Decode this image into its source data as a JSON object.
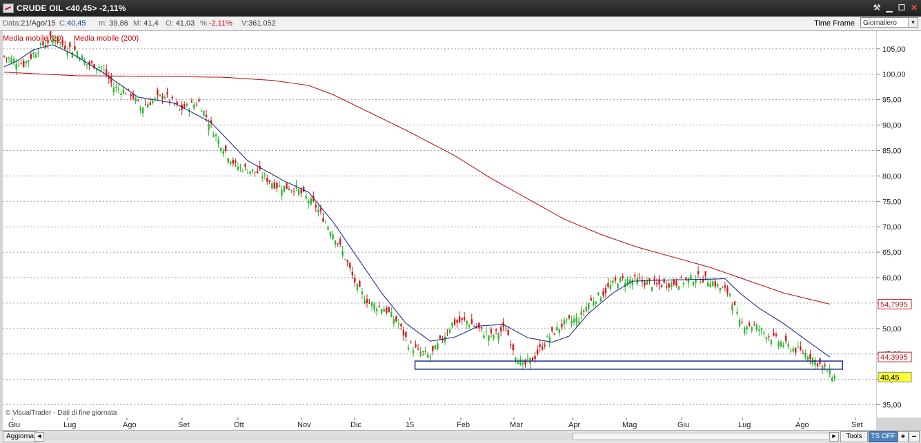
{
  "window": {
    "title": "CRUDE OIL <40,45> -2,11%"
  },
  "info": {
    "data_label": "Data:",
    "data_value": "21/Ago/15",
    "c_label": "C:",
    "c_value": "40,45",
    "m_label": "m:",
    "m_value": "39,86",
    "M_label": "M:",
    "M_value": "41,4",
    "o_label": "O:",
    "o_value": "41,03",
    "pct_label": "%:",
    "pct_value": "-2,11%",
    "v_label": "V:",
    "v_value": "361.052"
  },
  "timeframe": {
    "label": "Time Frame",
    "selected": "Giornaliero"
  },
  "legend": {
    "ma20": "Media mobile (20)",
    "ma200": "Media mobile (200)"
  },
  "watermark": "© VisualTrader - Dati di fine giornata",
  "bottombar": {
    "aggiorna": "Aggiorna",
    "tools": "Tools",
    "ts_off": "TS OFF",
    "plus": "+",
    "minus": "−"
  },
  "price_labels": {
    "ma200": "54,7995",
    "ma20": "44,3995",
    "last": "40,45"
  },
  "colors": {
    "up": "#2db82d",
    "down": "#d21a1a",
    "ma20": "#1c2f8c",
    "ma200": "#c01818",
    "support": "#1c2f8c",
    "last_bg": "#ffff33"
  },
  "chart_data": {
    "type": "candlestick",
    "y_ticks": [
      "105,00",
      "100,00",
      "95,00",
      "90,00",
      "85,00",
      "80,00",
      "75,00",
      "70,00",
      "65,00",
      "60,00",
      "55,00",
      "50,00",
      "45,00",
      "40,00",
      "35,00"
    ],
    "ylim": [
      32.5,
      108.5
    ],
    "x_ticks": [
      "Giu",
      "Lug",
      "Ago",
      "Set",
      "Ott",
      "Nov",
      "Dic",
      "15",
      "Feb",
      "Mar",
      "Apr",
      "Mag",
      "Giu",
      "Lug",
      "Ago",
      "Set"
    ],
    "price_path": [
      [
        0,
        103.5
      ],
      [
        8,
        102
      ],
      [
        14,
        105
      ],
      [
        20,
        107.3
      ],
      [
        25,
        105.5
      ],
      [
        30,
        104.5
      ],
      [
        34,
        102
      ],
      [
        40,
        101.5
      ],
      [
        45,
        97.5
      ],
      [
        52,
        96.2
      ],
      [
        56,
        93.5
      ],
      [
        62,
        95
      ],
      [
        66,
        96
      ],
      [
        72,
        93
      ],
      [
        80,
        94.5
      ],
      [
        88,
        87
      ],
      [
        95,
        82
      ],
      [
        105,
        80.5
      ],
      [
        112,
        78
      ],
      [
        120,
        77.5
      ],
      [
        128,
        74
      ],
      [
        132,
        71
      ],
      [
        136,
        68
      ],
      [
        140,
        64
      ],
      [
        145,
        58
      ],
      [
        150,
        55
      ],
      [
        156,
        54
      ],
      [
        162,
        51
      ],
      [
        166,
        47
      ],
      [
        170,
        45.5
      ],
      [
        175,
        44.5
      ],
      [
        180,
        48
      ],
      [
        184,
        51
      ],
      [
        190,
        51.5
      ],
      [
        196,
        49.5
      ],
      [
        200,
        48.5
      ],
      [
        206,
        50
      ],
      [
        210,
        45
      ],
      [
        213,
        42.5
      ],
      [
        218,
        44.5
      ],
      [
        224,
        48.5
      ],
      [
        230,
        51
      ],
      [
        236,
        52
      ],
      [
        240,
        55
      ],
      [
        246,
        57
      ],
      [
        252,
        59.5
      ],
      [
        260,
        59.5
      ],
      [
        268,
        58.5
      ],
      [
        276,
        59
      ],
      [
        284,
        60
      ],
      [
        290,
        59.5
      ],
      [
        294,
        58
      ],
      [
        298,
        57
      ],
      [
        302,
        51
      ],
      [
        308,
        50.5
      ],
      [
        316,
        48
      ],
      [
        324,
        46
      ],
      [
        330,
        45
      ],
      [
        336,
        42.5
      ],
      [
        341,
        40.45
      ]
    ],
    "ma20_path": [
      [
        0,
        101.5
      ],
      [
        5,
        102.5
      ],
      [
        12,
        104.8
      ],
      [
        20,
        105.8
      ],
      [
        28,
        104
      ],
      [
        40,
        100.5
      ],
      [
        55,
        95.5
      ],
      [
        70,
        94.3
      ],
      [
        85,
        90.5
      ],
      [
        100,
        83
      ],
      [
        115,
        79
      ],
      [
        125,
        76.8
      ],
      [
        135,
        71
      ],
      [
        145,
        64
      ],
      [
        155,
        57
      ],
      [
        165,
        51
      ],
      [
        175,
        47.5
      ],
      [
        185,
        48.3
      ],
      [
        195,
        50.5
      ],
      [
        205,
        50.8
      ],
      [
        215,
        48.2
      ],
      [
        225,
        47.3
      ],
      [
        232,
        48.5
      ],
      [
        240,
        53
      ],
      [
        250,
        57
      ],
      [
        258,
        59.3
      ],
      [
        268,
        59.5
      ],
      [
        280,
        59.6
      ],
      [
        290,
        59.7
      ],
      [
        296,
        59.8
      ],
      [
        302,
        57
      ],
      [
        310,
        54
      ],
      [
        320,
        51
      ],
      [
        330,
        47.5
      ],
      [
        339,
        44.3995
      ]
    ],
    "ma200_path": [
      [
        0,
        100.4
      ],
      [
        30,
        99.7
      ],
      [
        60,
        99.6
      ],
      [
        90,
        99.4
      ],
      [
        110,
        98.8
      ],
      [
        125,
        97.8
      ],
      [
        135,
        96
      ],
      [
        150,
        92.5
      ],
      [
        165,
        89
      ],
      [
        185,
        84
      ],
      [
        200,
        79.5
      ],
      [
        215,
        75.5
      ],
      [
        230,
        71.5
      ],
      [
        245,
        68.5
      ],
      [
        260,
        66
      ],
      [
        275,
        64
      ],
      [
        290,
        62
      ],
      [
        305,
        59.5
      ],
      [
        320,
        57
      ],
      [
        339,
        54.7995
      ]
    ],
    "support": {
      "low": 42.0,
      "high": 43.6,
      "from_bar": 169,
      "to_bar": 344
    },
    "n_bars": 345
  }
}
